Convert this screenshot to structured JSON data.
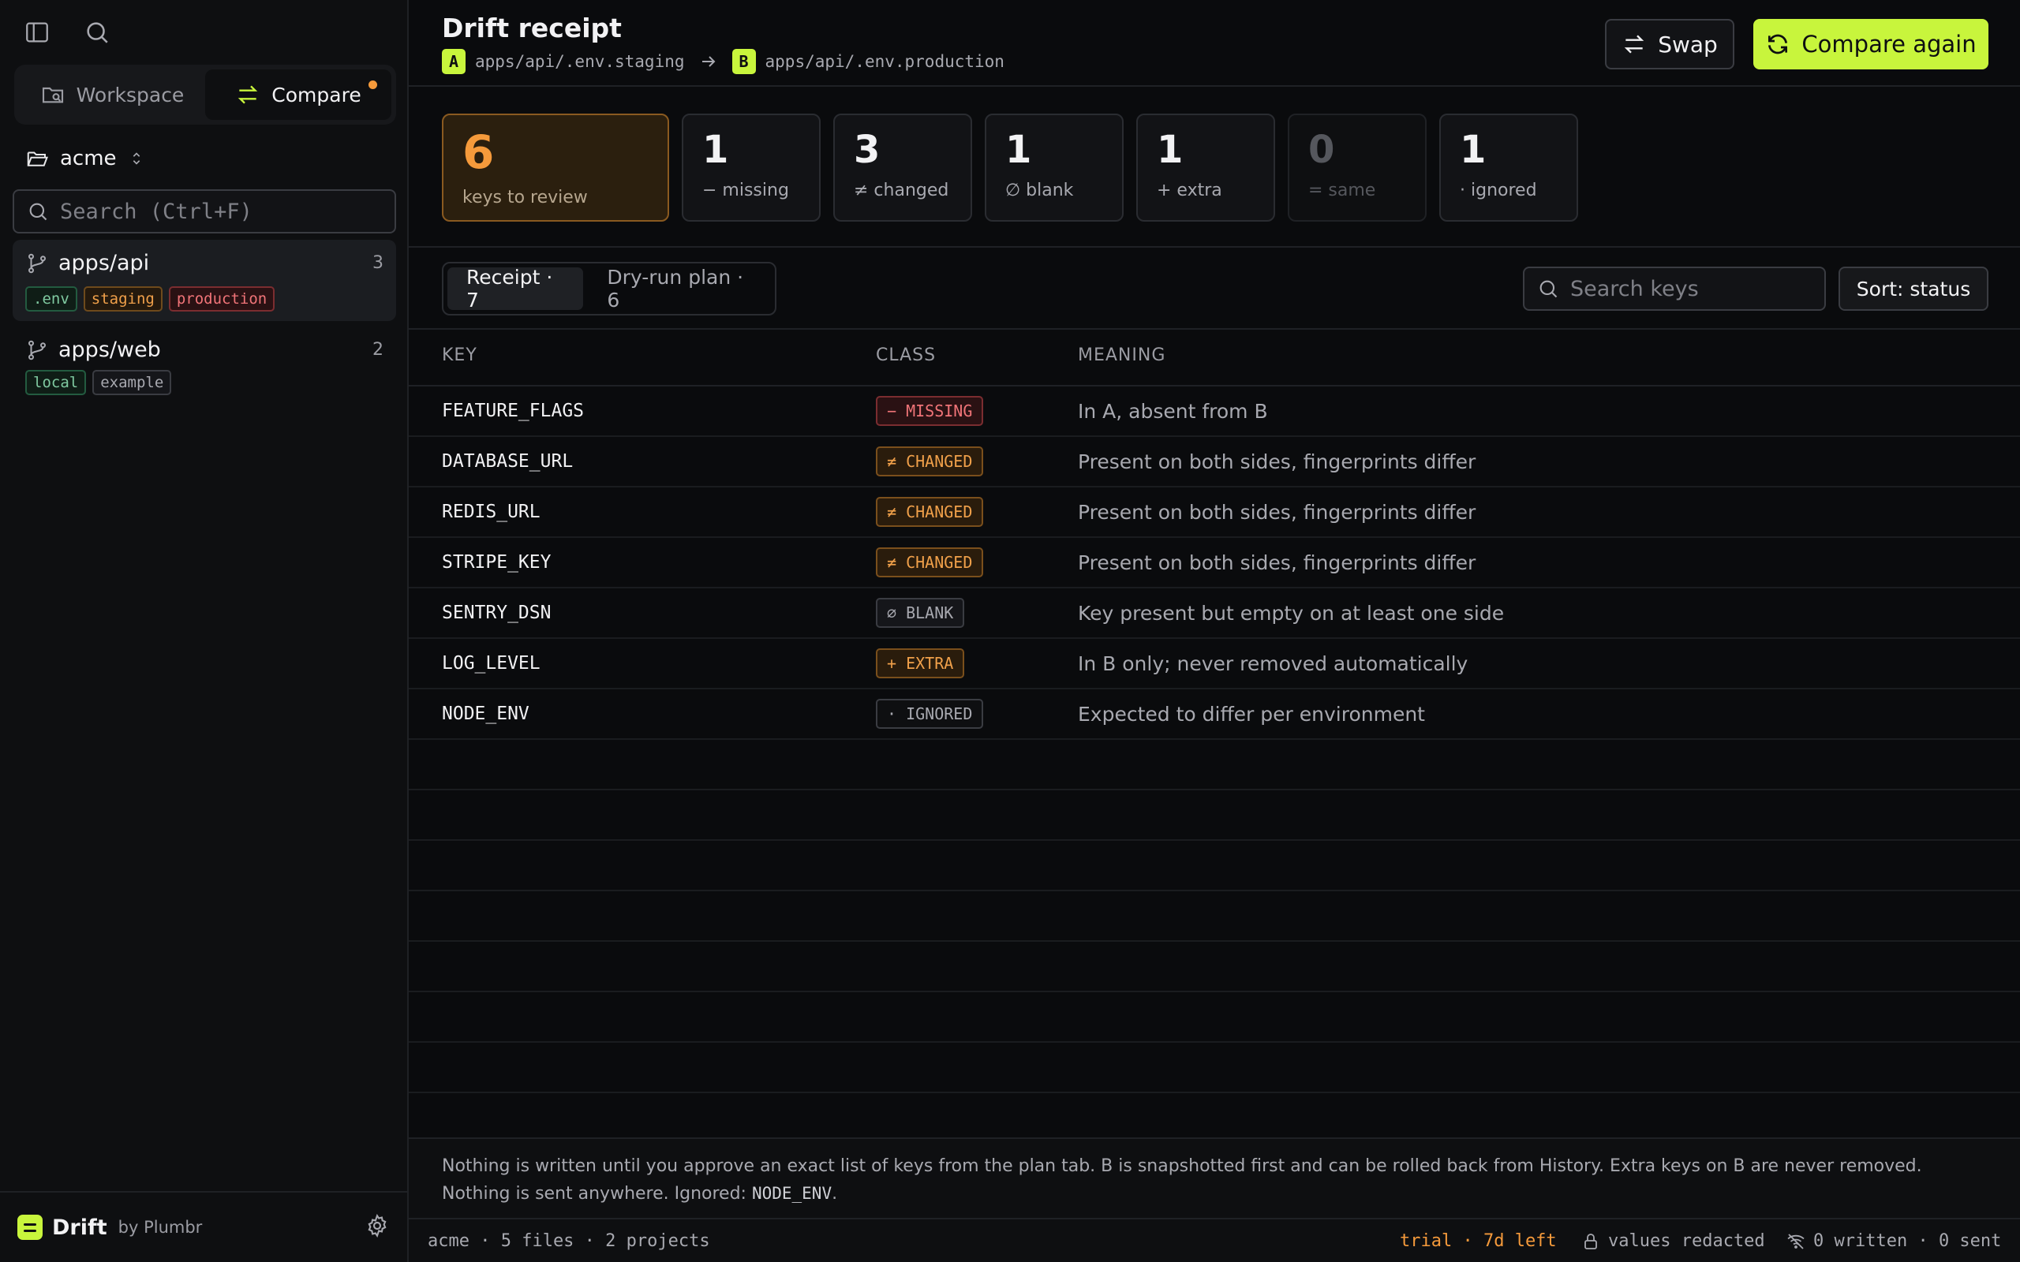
{
  "sidebar": {
    "tabs": [
      {
        "label": "Workspace",
        "icon": "search-folder-icon",
        "active": false
      },
      {
        "label": "Compare",
        "icon": "swap-arrows-icon",
        "active": true
      }
    ],
    "workspace": "acme",
    "search_placeholder": "Search (Ctrl+F)",
    "projects": [
      {
        "name": "apps/api",
        "count": "3",
        "chips": [
          ".env",
          "staging",
          "production"
        ]
      },
      {
        "name": "apps/web",
        "count": "2",
        "chips": [
          "local",
          "example"
        ]
      }
    ],
    "brand": {
      "name": "Drift",
      "by": "by Plumbr"
    }
  },
  "header": {
    "title": "Drift receipt",
    "a_tag": "A",
    "a_path": "apps/api/.env.staging",
    "b_tag": "B",
    "b_path": "apps/api/.env.production",
    "swap_label": "Swap",
    "compare_label": "Compare again"
  },
  "stats": {
    "review": {
      "value": "6",
      "label": "keys to review"
    },
    "missing": {
      "value": "1",
      "label": "− missing"
    },
    "changed": {
      "value": "3",
      "label": "≠ changed"
    },
    "blank": {
      "value": "1",
      "label": "∅ blank"
    },
    "extra": {
      "value": "1",
      "label": "+ extra"
    },
    "same": {
      "value": "0",
      "label": "= same"
    },
    "ignored": {
      "value": "1",
      "label": "· ignored"
    }
  },
  "tabs": [
    {
      "label": "Receipt · 7",
      "active": true
    },
    {
      "label": "Dry-run plan · 6",
      "active": false
    }
  ],
  "key_search_placeholder": "Search keys",
  "sort_label": "Sort: status",
  "table": {
    "headers": [
      "KEY",
      "CLASS",
      "MEANING"
    ],
    "rows": [
      {
        "key": "FEATURE_FLAGS",
        "cls": "− MISSING",
        "meaning": "In A, absent from B"
      },
      {
        "key": "DATABASE_URL",
        "cls": "≠ CHANGED",
        "meaning": "Present on both sides, fingerprints differ"
      },
      {
        "key": "REDIS_URL",
        "cls": "≠ CHANGED",
        "meaning": "Present on both sides, fingerprints differ"
      },
      {
        "key": "STRIPE_KEY",
        "cls": "≠ CHANGED",
        "meaning": "Present on both sides, fingerprints differ"
      },
      {
        "key": "SENTRY_DSN",
        "cls": "∅ BLANK",
        "meaning": "Key present but empty on at least one side"
      },
      {
        "key": "LOG_LEVEL",
        "cls": "+ EXTRA",
        "meaning": "In B only; never removed automatically"
      },
      {
        "key": "NODE_ENV",
        "cls": "· IGNORED",
        "meaning": "Expected to differ per environment"
      }
    ]
  },
  "notice": {
    "line1": "Nothing is written until you approve an exact list of keys from the plan tab. B is snapshotted first and can be rolled back from History. Extra keys on B are never removed.",
    "line2_prefix": "Nothing is sent anywhere. Ignored: ",
    "ignored_key": "NODE_ENV",
    "line2_suffix": "."
  },
  "statusbar": {
    "left": "acme · 5 files · 2 projects",
    "trial": "trial · 7d left",
    "redacted": "values redacted",
    "sent": "0 written · 0 sent"
  },
  "colors": {
    "accent": "#c8f53c",
    "warning": "#f59a3b",
    "danger": "#f07478"
  }
}
